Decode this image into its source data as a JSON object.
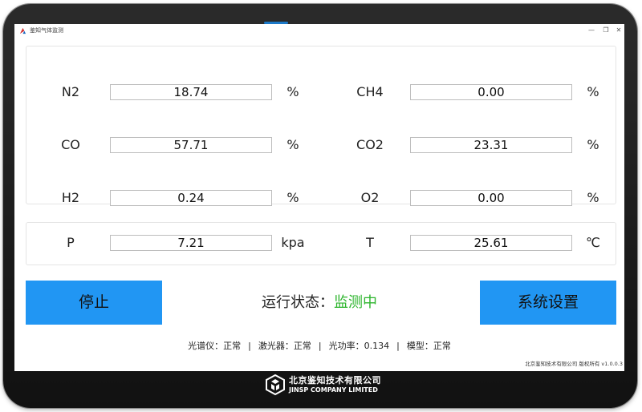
{
  "window": {
    "title": "鉴知气体监测",
    "minimize_glyph": "—",
    "maximize_glyph": "❐",
    "close_glyph": "✕"
  },
  "gases": [
    {
      "label": "N2",
      "value": "18.74",
      "unit": "%"
    },
    {
      "label": "CH4",
      "value": "0.00",
      "unit": "%"
    },
    {
      "label": "CO",
      "value": "57.71",
      "unit": "%"
    },
    {
      "label": "CO2",
      "value": "23.31",
      "unit": "%"
    },
    {
      "label": "H2",
      "value": "0.24",
      "unit": "%"
    },
    {
      "label": "O2",
      "value": "0.00",
      "unit": "%"
    }
  ],
  "pressure": {
    "label": "P",
    "value": "7.21",
    "unit": "kpa"
  },
  "temperature": {
    "label": "T",
    "value": "25.61",
    "unit": "℃"
  },
  "controls": {
    "stop_label": "停止",
    "settings_label": "系统设置"
  },
  "status": {
    "label": "运行状态：",
    "value": "监测中",
    "value_color": "#2db52d"
  },
  "devices": {
    "spectrometer": "光谱仪：正常",
    "laser": "激光器：正常",
    "optical_power": "光功率：0.134",
    "model": "模型：正常",
    "separator": "|"
  },
  "copyright": "北京鉴知技术有限公司 版权所有 v1.0.0.3",
  "brand": {
    "name_cn": "北京鉴知技术有限公司",
    "name_en": "JINSP COMPANY LIMITED"
  },
  "colors": {
    "button_blue": "#2196f3",
    "bezel": "#1a1a1a"
  }
}
